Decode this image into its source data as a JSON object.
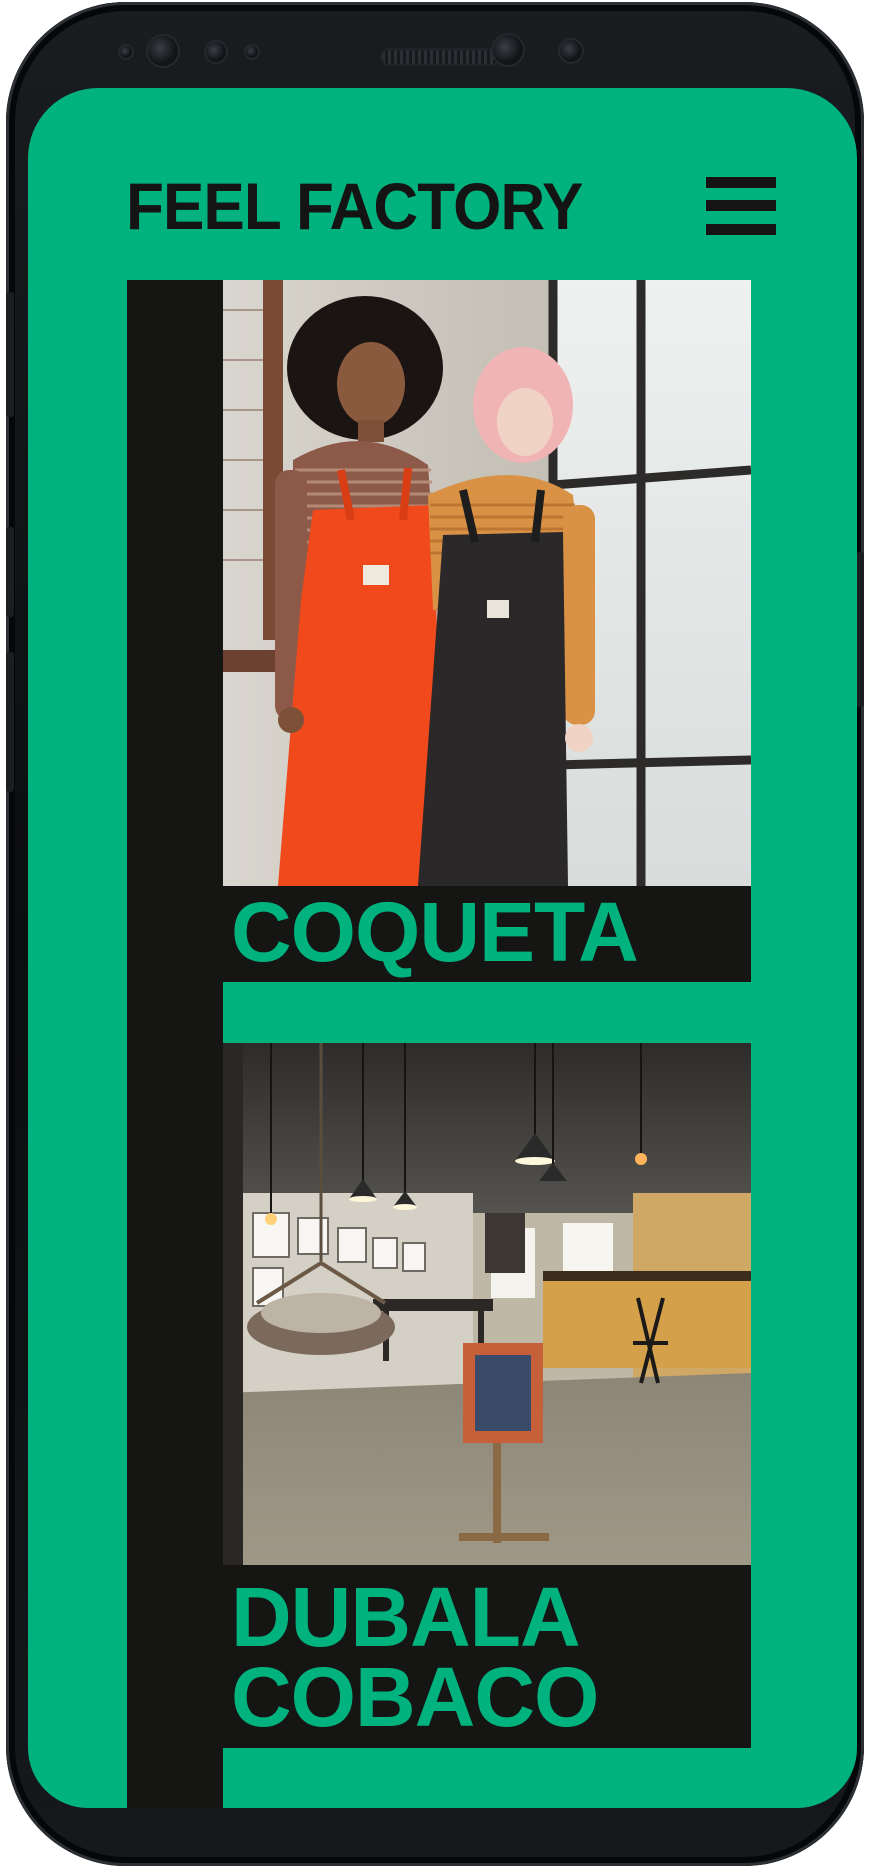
{
  "app": {
    "brand": "FEEL FACTORY",
    "menu_icon": "hamburger-menu-icon"
  },
  "colors": {
    "accent": "#00b37e",
    "dark": "#151614"
  },
  "cards": [
    {
      "title": "COQUETA",
      "image": "two models in orange and black overalls"
    },
    {
      "title": "DUBALA\nCOBACO",
      "image": "tattoo studio interior with hanging chair and pendant lamps"
    }
  ]
}
